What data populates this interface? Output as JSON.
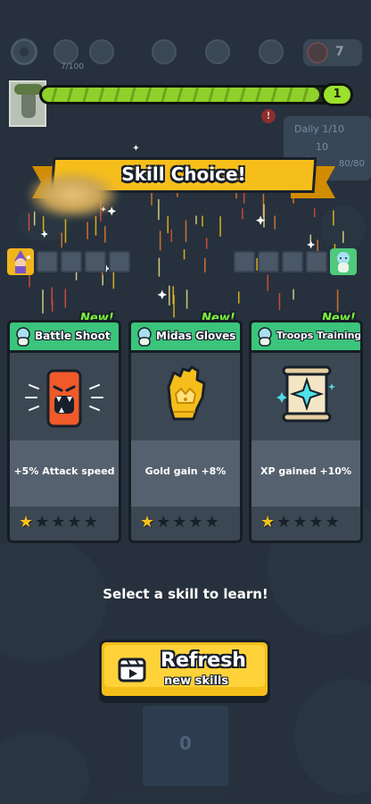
{
  "hud": {
    "progress_text": "7/100",
    "coins": "7"
  },
  "xp": {
    "level": "1",
    "progress": 0.96
  },
  "daily": {
    "label": "Daily 1/10",
    "count": "10",
    "total": "80/80"
  },
  "title": "Skill Choice!",
  "cards": [
    {
      "new_tag": "New!",
      "name": "Battle Shoot",
      "description": "+5% Attack speed",
      "stars": 1,
      "max_stars": 5,
      "art_icon": "angry-phone-icon"
    },
    {
      "new_tag": "New!",
      "name": "Midas Gloves",
      "description": "Gold gain +8%",
      "stars": 1,
      "max_stars": 5,
      "art_icon": "golden-glove-icon"
    },
    {
      "new_tag": "New!",
      "name": "Troops Training",
      "description": "XP gained +10%",
      "stars": 1,
      "max_stars": 5,
      "art_icon": "scroll-icon"
    }
  ],
  "prompt": "Select a skill to learn!",
  "refresh": {
    "title": "Refresh",
    "subtitle": "new skills"
  },
  "bottom_count": "0",
  "colors": {
    "background": "#2b3744",
    "banner": "#f6be1a",
    "card_header": "#3bc47c",
    "new_tag": "#7cf23c",
    "xp": "#8fd12a",
    "star_on": "#f6c21a"
  }
}
